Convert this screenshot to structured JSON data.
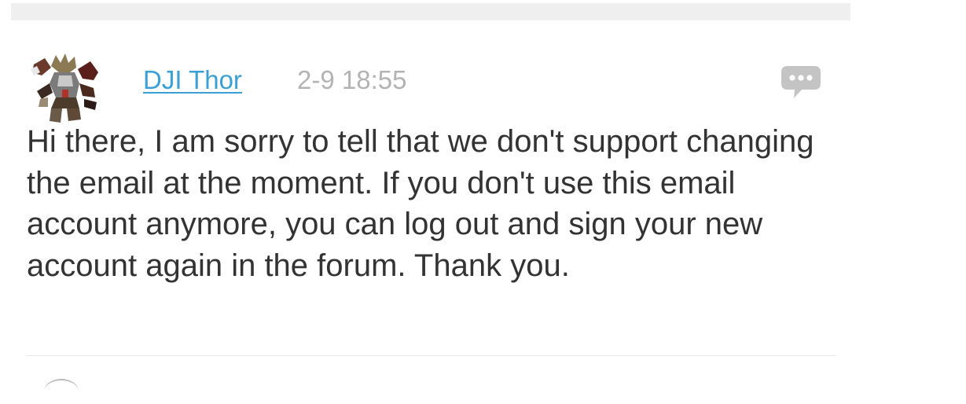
{
  "post": {
    "author": "DJI Thor",
    "timestamp": "2-9 18:55",
    "message": "Hi there, I am sorry to tell that we don't support changing the email at the moment. If you don't use this email account anymore, you can log out and sign your new account again in the forum. Thank you.",
    "reply_icon": "speech-bubble-dots-icon"
  },
  "colors": {
    "author_link": "#3aa0d6",
    "timestamp": "#b3b3b3",
    "body_text": "#333333",
    "reply_icon": "#c4c4c4",
    "top_bar": "#efefef",
    "divider": "#e6e6e6"
  }
}
